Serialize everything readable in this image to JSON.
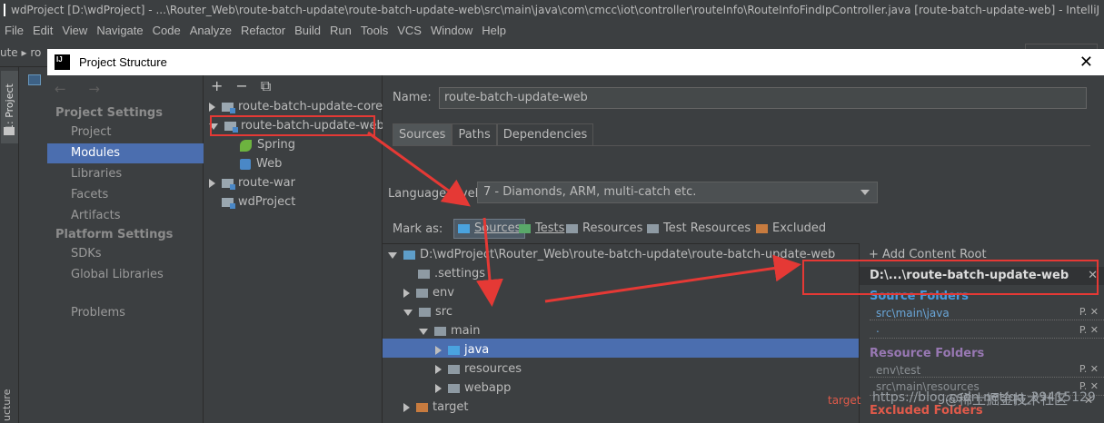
{
  "ide": {
    "title": "wdProject [D:\\wdProject] - ...\\Router_Web\\route-batch-update\\route-batch-update-web\\src\\main\\java\\com\\cmcc\\iot\\controller\\routeInfo\\RouteInfoFindIpController.java [route-batch-update-web] - IntelliJ I...",
    "menu": [
      "File",
      "Edit",
      "View",
      "Navigate",
      "Code",
      "Analyze",
      "Refactor",
      "Build",
      "Run",
      "Tools",
      "VCS",
      "Window",
      "Help"
    ],
    "breadcrumb": "ute ▸ ro",
    "left_tab_top": "1: Project",
    "left_tab_bottom": "ucture"
  },
  "dialog": {
    "title": "Project Structure",
    "nav_arrows": "← →",
    "project_settings_header": "Project Settings",
    "project_settings": [
      "Project",
      "Modules",
      "Libraries",
      "Facets",
      "Artifacts"
    ],
    "platform_settings_header": "Platform Settings",
    "platform_settings": [
      "SDKs",
      "Global Libraries"
    ],
    "problems": "Problems",
    "selected_nav": "Modules"
  },
  "modules": {
    "tools": [
      "+",
      "−",
      "⧉"
    ],
    "tree": [
      {
        "label": "route-batch-update-core"
      },
      {
        "label": "route-batch-update-web"
      },
      {
        "label": "Spring"
      },
      {
        "label": "Web"
      },
      {
        "label": "route-war"
      },
      {
        "label": "wdProject"
      }
    ]
  },
  "module_detail": {
    "name_label": "Name:",
    "name_value": "route-batch-update-web",
    "tabs": [
      "Sources",
      "Paths",
      "Dependencies"
    ],
    "language_level_label": "Language level:",
    "language_level": "7 - Diamonds, ARM, multi-catch etc.",
    "mark_as_label": "Mark as:",
    "mark_as": [
      "Sources",
      "Tests",
      "Resources",
      "Test Resources",
      "Excluded"
    ],
    "content_tree": [
      {
        "label": "D:\\wdProject\\Router_Web\\route-batch-update\\route-batch-update-web"
      },
      {
        "label": ".settings"
      },
      {
        "label": "env"
      },
      {
        "label": "src"
      },
      {
        "label": "main"
      },
      {
        "label": "java"
      },
      {
        "label": "resources"
      },
      {
        "label": "webapp"
      },
      {
        "label": "target"
      }
    ]
  },
  "content_root": {
    "add_label": "+ Add Content Root",
    "root_path": "D:\\...\\route-batch-update-web",
    "source_folders_header": "Source Folders",
    "source_folders": [
      "src\\main\\java",
      "."
    ],
    "resource_folders_header": "Resource Folders",
    "resource_folders": [
      "env\\test",
      "src\\main\\resources"
    ],
    "excluded_folders_header": "Excluded Folders",
    "excluded_folders": [
      "target"
    ],
    "props_glyph": "P.",
    "close_glyph": "✕"
  },
  "watermark": {
    "left": "https://blog.csdn.net/qq_39415129",
    "right": "@稀土掘金技术社区"
  },
  "colors": {
    "selection": "#4b6eaf",
    "source_header": "#4a9ade",
    "resource_header": "#9878b3",
    "excluded_header": "#e05a4a",
    "annotation_red": "#e53935"
  }
}
